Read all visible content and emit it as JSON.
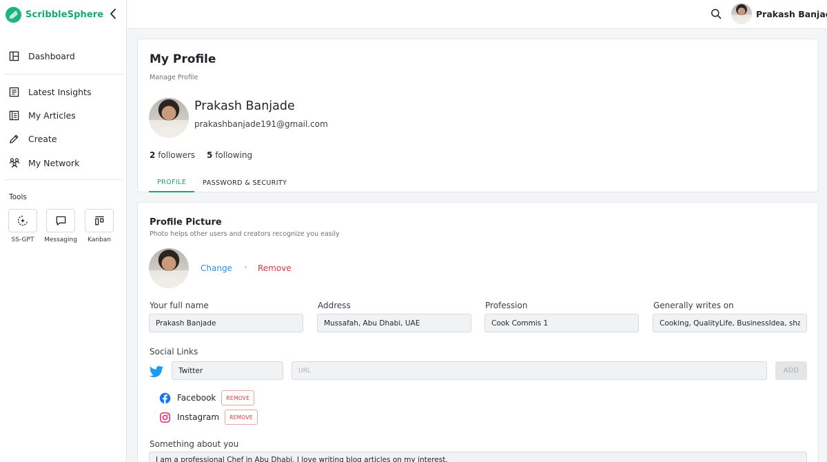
{
  "brand": {
    "name": "ScribbleSphere",
    "accent": "#16a86f"
  },
  "sidebar": {
    "items": [
      {
        "label": "Dashboard",
        "icon": "dashboard-icon"
      },
      {
        "label": "Latest Insights",
        "icon": "insights-icon"
      },
      {
        "label": "My Articles",
        "icon": "articles-icon"
      },
      {
        "label": "Create",
        "icon": "pencil-icon"
      },
      {
        "label": "My Network",
        "icon": "network-icon"
      }
    ],
    "tools_label": "Tools",
    "tools": [
      {
        "label": "SS-GPT",
        "icon": "ai-sparkle-icon"
      },
      {
        "label": "Messaging",
        "icon": "chat-icon"
      },
      {
        "label": "Kanban",
        "icon": "kanban-icon"
      }
    ]
  },
  "topbar": {
    "user_name": "Prakash Banjade"
  },
  "profile": {
    "title": "My Profile",
    "subtitle": "Manage Profile",
    "name": "Prakash Banjade",
    "email": "prakashbanjade191@gmail.com",
    "followers_count": "2",
    "followers_label": "followers",
    "following_count": "5",
    "following_label": "following",
    "tabs": [
      {
        "label": "PROFILE",
        "active": true
      },
      {
        "label": "PASSWORD & SECURITY",
        "active": false
      }
    ]
  },
  "picture": {
    "title": "Profile Picture",
    "subtitle": "Photo helps other users and creators recognize you easily",
    "change_label": "Change",
    "remove_label": "Remove"
  },
  "fields": [
    {
      "label": "Your full name",
      "value": "Prakash Banjade"
    },
    {
      "label": "Address",
      "value": "Mussafah, Abu Dhabi, UAE"
    },
    {
      "label": "Profession",
      "value": "Cook Commis 1"
    },
    {
      "label": "Generally writes on",
      "value": "Cooking, QualityLife, BusinessIdea, sharemarket"
    }
  ],
  "social": {
    "label": "Social Links",
    "new_link": {
      "platform": "Twitter",
      "url_placeholder": "URL",
      "add_label": "ADD"
    },
    "links": [
      {
        "name": "Facebook",
        "remove_label": "REMOVE"
      },
      {
        "name": "Instagram",
        "remove_label": "REMOVE"
      }
    ]
  },
  "about": {
    "label": "Something about you",
    "value": "I am a professional Chef in Abu Dhabi. I love writing blog articles on my interest."
  }
}
